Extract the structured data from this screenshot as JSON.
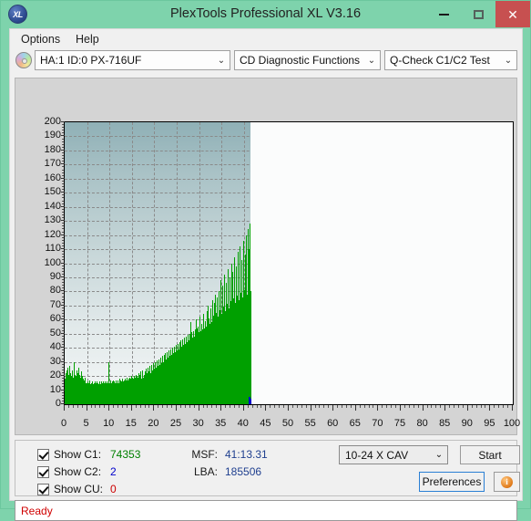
{
  "window": {
    "title": "PlexTools Professional XL V3.16",
    "app_icon": "XL",
    "minimize_label": "–",
    "maximize_label": "□",
    "close_label": "✕"
  },
  "menu": {
    "items": [
      {
        "label": "Options"
      },
      {
        "label": "Help"
      }
    ]
  },
  "selectors": {
    "drive": {
      "value": "HA:1 ID:0  PX-716UF",
      "arrow": "⌄"
    },
    "function": {
      "value": "CD Diagnostic Functions",
      "arrow": "⌄"
    },
    "test": {
      "value": "Q-Check C1/C2 Test",
      "arrow": "⌄"
    }
  },
  "controls": {
    "checkboxes": [
      {
        "label": "Show C1:",
        "value": "74353",
        "color": "#008000"
      },
      {
        "label": "Show C2:",
        "value": "2",
        "color": "#0000cc"
      },
      {
        "label": "Show CU:",
        "value": "0",
        "color": "#cc0000"
      }
    ],
    "msf_label": "MSF:",
    "msf_value": "41:13.31",
    "lba_label": "LBA:",
    "lba_value": "185506",
    "speed": {
      "value": "10-24 X CAV",
      "arrow": "⌄"
    },
    "start_label": "Start",
    "preferences_label": "Preferences",
    "info_label": "i"
  },
  "status": {
    "text": "Ready"
  },
  "chart_data": {
    "type": "bar",
    "title": "",
    "xlabel": "",
    "ylabel": "",
    "xlim": [
      0,
      100
    ],
    "ylim": [
      0,
      200
    ],
    "ytick_step": 10,
    "xtick_step": 5,
    "xticks": [
      0,
      5,
      10,
      15,
      20,
      25,
      30,
      35,
      40,
      45,
      50,
      55,
      60,
      65,
      70,
      75,
      80,
      85,
      90,
      95,
      100
    ],
    "yticks": [
      0,
      10,
      20,
      30,
      40,
      50,
      60,
      70,
      80,
      90,
      100,
      110,
      120,
      130,
      140,
      150,
      160,
      170,
      180,
      190,
      200
    ],
    "grid": true,
    "legend": "none",
    "scanned_to_x": 41.5,
    "series": [
      {
        "name": "C1",
        "color": "#00a000",
        "values": [
          14,
          18,
          13,
          22,
          11,
          16,
          20,
          12,
          17,
          24,
          13,
          15,
          19,
          12,
          26,
          14,
          11,
          21,
          16,
          13,
          18,
          12,
          27,
          15,
          11,
          19,
          14,
          22,
          12,
          16,
          13,
          20,
          15,
          11,
          24,
          13,
          17,
          12,
          19,
          14,
          16,
          30,
          12,
          18,
          13,
          21,
          15,
          11,
          17,
          13,
          20,
          16,
          12,
          24,
          14,
          11,
          19,
          15,
          13,
          22,
          12,
          17,
          14,
          11,
          26,
          13,
          18,
          12,
          16,
          21,
          14,
          11,
          19,
          13,
          23,
          15,
          12,
          17,
          14,
          11,
          16,
          12,
          20,
          13,
          18,
          11,
          15,
          12,
          17,
          14,
          11,
          19,
          13,
          16,
          12,
          15,
          11,
          14,
          13,
          12,
          15,
          11,
          13,
          12,
          14,
          11,
          16,
          12,
          13,
          11,
          15,
          12,
          14,
          11,
          13,
          17,
          12,
          14,
          11,
          13,
          12,
          15,
          11,
          14,
          12,
          13,
          11,
          16,
          12,
          14,
          11,
          13,
          12,
          15,
          11,
          14,
          12,
          16,
          11,
          13,
          12,
          14,
          11,
          15,
          12,
          13,
          11,
          14,
          16,
          12,
          13,
          11,
          15,
          12,
          14,
          11,
          13,
          12,
          16,
          11,
          14,
          12,
          15,
          11,
          13,
          14,
          12,
          16,
          11,
          13,
          12,
          15,
          11,
          14,
          12,
          13,
          16,
          11,
          14,
          12,
          15,
          11,
          13,
          12,
          14,
          16,
          11,
          13,
          12,
          15,
          11,
          14,
          12,
          13,
          16,
          12,
          14,
          11,
          15,
          13,
          12,
          30,
          14,
          11,
          16,
          12,
          15,
          13,
          11,
          14,
          12,
          17,
          13,
          11,
          15,
          12,
          14,
          16,
          11,
          13,
          12,
          15,
          14,
          11,
          17,
          13,
          12,
          16,
          11,
          14,
          12,
          15,
          13,
          11,
          16,
          12,
          14,
          17,
          13,
          11,
          15,
          12,
          14,
          16,
          13,
          11,
          17,
          12,
          15,
          13,
          14,
          11,
          16,
          12,
          18,
          13,
          15,
          11,
          14,
          17,
          12,
          16,
          13,
          15,
          11,
          18,
          12,
          14,
          16,
          13,
          15,
          11,
          17,
          12,
          16,
          14,
          13,
          18,
          11,
          15,
          12,
          17,
          14,
          16,
          13,
          12,
          19,
          15,
          11,
          17,
          13,
          16,
          12,
          18,
          14,
          15,
          13,
          11,
          19,
          16,
          12,
          17,
          14,
          18,
          13,
          15,
          12,
          20,
          16,
          14,
          17,
          13,
          19,
          11,
          15,
          18,
          13,
          16,
          12,
          20,
          15,
          17,
          14,
          19,
          13,
          16,
          12,
          21,
          15,
          18,
          14,
          17,
          13,
          20,
          12,
          16,
          19,
          14,
          17,
          13,
          22,
          15,
          18,
          14,
          21,
          16,
          13,
          19,
          12,
          17,
          15,
          23,
          14,
          18,
          16,
          13,
          20,
          12,
          17,
          15,
          24,
          14,
          19,
          16,
          13,
          21,
          12,
          18,
          15,
          23,
          17,
          14,
          20,
          13,
          19,
          16,
          25,
          14,
          18,
          15,
          22,
          17,
          13,
          21,
          14,
          26,
          16,
          19,
          15,
          23,
          13,
          18,
          17,
          27,
          14,
          20,
          16,
          22,
          15,
          19,
          14,
          28,
          17,
          21,
          16,
          24,
          15,
          19,
          18,
          29,
          16,
          22,
          17,
          25,
          15,
          20,
          18,
          30,
          17,
          23,
          16,
          26,
          19,
          21,
          17,
          31,
          18,
          24,
          16,
          27,
          20,
          22,
          18,
          32,
          17,
          25,
          19,
          28,
          21,
          23,
          18,
          33,
          20,
          26,
          19,
          29,
          22,
          24,
          20,
          34,
          21,
          27,
          19,
          30,
          23,
          25,
          21,
          35,
          22,
          28,
          20,
          31,
          24,
          26,
          22,
          36,
          23,
          29,
          21,
          32,
          25,
          27,
          23,
          37,
          24,
          30,
          22,
          33,
          26,
          28,
          24,
          38,
          25,
          31,
          23,
          34,
          27,
          29,
          25,
          39,
          26,
          32,
          24,
          35,
          28,
          30,
          26,
          40,
          27,
          33,
          25,
          36,
          29,
          31,
          27,
          41,
          28,
          34,
          26,
          37,
          30,
          32,
          28,
          42,
          29,
          35,
          27,
          38,
          31,
          33,
          29,
          43,
          30,
          36,
          28,
          39,
          32,
          34,
          30,
          44,
          31,
          37,
          29,
          40,
          33,
          35,
          31,
          45,
          32,
          38,
          30,
          41,
          34,
          36,
          32,
          46,
          33,
          39,
          31,
          42,
          35,
          37,
          33,
          47,
          34,
          40,
          32,
          43,
          36,
          38,
          34,
          48,
          35,
          41,
          33,
          44,
          37,
          39,
          35,
          49,
          36,
          42,
          34,
          45,
          38,
          40,
          36,
          50,
          37,
          43,
          35,
          58,
          39,
          41,
          37,
          51,
          38,
          44,
          36,
          47,
          40,
          42,
          38,
          52,
          39,
          45,
          37,
          48,
          41,
          43,
          39,
          53,
          40,
          46,
          38,
          60,
          42,
          44,
          40,
          54,
          41,
          47,
          39,
          50,
          43,
          45,
          41,
          55,
          42,
          48,
          40,
          51,
          44,
          46,
          42,
          62,
          43,
          49,
          41,
          52,
          45,
          47,
          43,
          57,
          44,
          50,
          42,
          53,
          46,
          48,
          44,
          64,
          45,
          51,
          43,
          54,
          47,
          49,
          45,
          59,
          46,
          52,
          44,
          55,
          48,
          50,
          46,
          66,
          47,
          53,
          45,
          70,
          49,
          51,
          47,
          61,
          48,
          54,
          46,
          57,
          50,
          52,
          48,
          68,
          49,
          55,
          47,
          58,
          51,
          53,
          49,
          74,
          50,
          56,
          48,
          63,
          52,
          54,
          50,
          72,
          51,
          57,
          49,
          60,
          53,
          55,
          51,
          78,
          52,
          58,
          50,
          65,
          54,
          56,
          52,
          76,
          53,
          59,
          51,
          62,
          55,
          57,
          53,
          80,
          54,
          60,
          52,
          67,
          56,
          58,
          54,
          88,
          55,
          61,
          53,
          64,
          57,
          59,
          55,
          84,
          56,
          62,
          54,
          69,
          58,
          60,
          56,
          92,
          57,
          63,
          55,
          66,
          59,
          61,
          57,
          86,
          58,
          64,
          56,
          71,
          60,
          62,
          58,
          96,
          59,
          65,
          57,
          68,
          61,
          63,
          59,
          90,
          60,
          66,
          58,
          73,
          62,
          64,
          60,
          100,
          61,
          67,
          59,
          70,
          63,
          65,
          61,
          94,
          62,
          68,
          60,
          75,
          64,
          66,
          62,
          104,
          63,
          69,
          61,
          72,
          65,
          67,
          63,
          98,
          64,
          70,
          62,
          77,
          66,
          68,
          64,
          108,
          65,
          71,
          63,
          74,
          67,
          69,
          65,
          112,
          66,
          72,
          64,
          79,
          68,
          70,
          66,
          102,
          67,
          73,
          65,
          76,
          69,
          71,
          67,
          116,
          68,
          74,
          66,
          81,
          70,
          72,
          68,
          106,
          69,
          75,
          67,
          120,
          71,
          73,
          69,
          78,
          72,
          76,
          70,
          124,
          71,
          77,
          69,
          110,
          73,
          78,
          71,
          128,
          74,
          79,
          72,
          114,
          75,
          80
        ]
      },
      {
        "name": "C2",
        "color": "#0000cc",
        "points": [
          {
            "x": 41.0,
            "y": 5
          },
          {
            "x": 41.3,
            "y": 4
          }
        ]
      }
    ]
  }
}
